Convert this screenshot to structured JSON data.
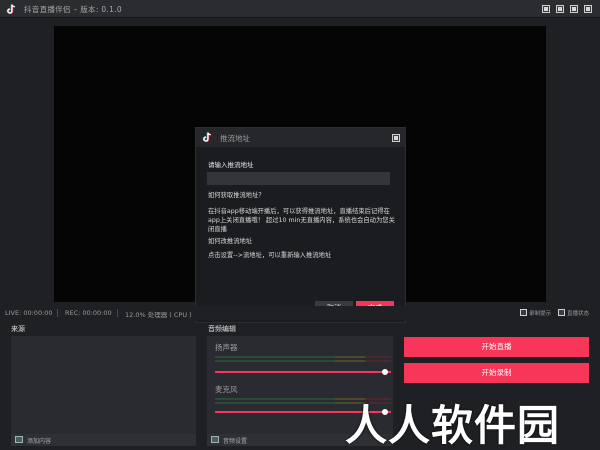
{
  "app": {
    "title": "抖音直播伴侣 – 版本: 0.1.0",
    "logo_icon": "tiktok-logo-icon",
    "window_controls": [
      "minimize-icon",
      "maximize-icon",
      "restore-icon",
      "close-icon"
    ]
  },
  "dialog": {
    "title": "推流地址",
    "input_label": "请输入推流地址",
    "input_value": "",
    "question1": "如何获取推流地址？",
    "answer1": "在抖音app移动端开播后，可以获得推流地址，直播结束后记得在app上关闭直播哦！ 超过10 min无直播内容，系统也会自动为您关闭直播",
    "question2": "如何改推流地址",
    "answer2": "点击设置-->流地址，可以重新输入推流地址",
    "cancel_label": "取消",
    "confirm_label": "完成"
  },
  "status": {
    "live": "LIVE: 00:00:00",
    "rec": "REC: 00:00:00",
    "cpu": "12.0% 处理器 ( CPU )",
    "check1": "录制提示",
    "check2": "直播状态"
  },
  "source": {
    "header": "来源",
    "add_label": "添加内容"
  },
  "audio": {
    "header": "音频编辑",
    "speaker_label": "扬声器",
    "mic_label": "麦克风",
    "settings_label": "音频设置",
    "speaker_volume": 1.0,
    "mic_volume": 1.0
  },
  "actions": {
    "start_live": "开始直播",
    "start_record": "开始录制"
  },
  "watermark": "人人软件园",
  "colors": {
    "accent": "#f8365a",
    "background": "#1f2024",
    "panel": "#2a2b30"
  }
}
